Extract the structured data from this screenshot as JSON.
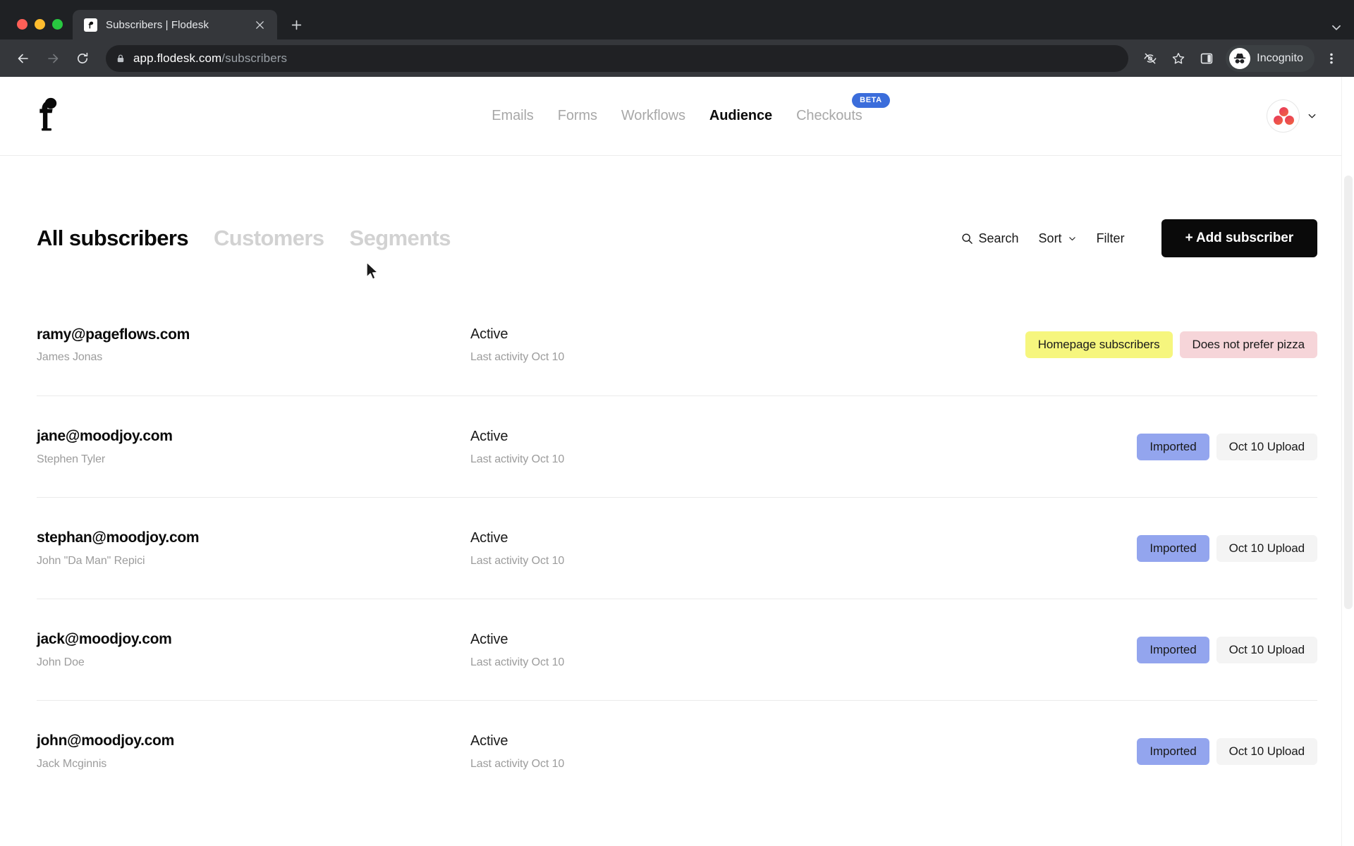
{
  "browser": {
    "tab": {
      "title": "Subscribers | Flodesk",
      "favicon": "flodesk-f-icon",
      "close_label": "×"
    },
    "new_tab_label": "+",
    "back_label": "←",
    "forward_label": "→",
    "reload_label": "⟳",
    "address": {
      "host": "app.flodesk.com",
      "path": "/subscribers",
      "lock_icon": "lock-icon"
    },
    "actions": {
      "third_party_cookies_icon": "eye-slash-icon",
      "bookmark_icon": "star-icon",
      "side_panel_icon": "side-panel-icon",
      "incognito_label": "Incognito",
      "incognito_icon": "incognito-hat-icon",
      "menu_icon": "kebab-menu-icon"
    }
  },
  "app": {
    "brand": {
      "logo_icon": "flodesk-logo-icon"
    },
    "nav": [
      {
        "label": "Emails",
        "active": false
      },
      {
        "label": "Forms",
        "active": false
      },
      {
        "label": "Workflows",
        "active": false
      },
      {
        "label": "Audience",
        "active": true
      },
      {
        "label": "Checkouts",
        "active": false,
        "badge": "BETA"
      }
    ],
    "account": {
      "avatar_icon": "user-avatar-icon",
      "chevron_icon": "chevron-down-icon"
    }
  },
  "page": {
    "view_tabs": [
      {
        "label": "All subscribers",
        "active": true
      },
      {
        "label": "Customers",
        "active": false
      },
      {
        "label": "Segments",
        "active": false
      }
    ],
    "actions": {
      "search_label": "Search",
      "search_icon": "search-icon",
      "sort_label": "Sort",
      "sort_icon": "chevron-down-icon",
      "filter_label": "Filter",
      "add_subscriber_label": "+ Add subscriber"
    },
    "subscribers": [
      {
        "email": "ramy@pageflows.com",
        "name": "James Jonas",
        "status": "Active",
        "activity": "Last activity Oct 10",
        "tags": [
          {
            "label": "Homepage subscribers",
            "bg": "#f6f67e",
            "color": "#1a1a1a"
          },
          {
            "label": "Does not prefer pizza",
            "bg": "#f6d5d9",
            "color": "#1a1a1a"
          }
        ]
      },
      {
        "email": "jane@moodjoy.com",
        "name": "Stephen Tyler",
        "status": "Active",
        "activity": "Last activity Oct 10",
        "tags": [
          {
            "label": "Imported",
            "bg": "#93a5ee",
            "color": "#1a1a1a"
          },
          {
            "label": "Oct 10 Upload",
            "bg": "#f4f4f4",
            "color": "#1a1a1a"
          }
        ]
      },
      {
        "email": "stephan@moodjoy.com",
        "name": "John \"Da Man\" Repici",
        "status": "Active",
        "activity": "Last activity Oct 10",
        "tags": [
          {
            "label": "Imported",
            "bg": "#93a5ee",
            "color": "#1a1a1a"
          },
          {
            "label": "Oct 10 Upload",
            "bg": "#f4f4f4",
            "color": "#1a1a1a"
          }
        ]
      },
      {
        "email": "jack@moodjoy.com",
        "name": "John Doe",
        "status": "Active",
        "activity": "Last activity Oct 10",
        "tags": [
          {
            "label": "Imported",
            "bg": "#93a5ee",
            "color": "#1a1a1a"
          },
          {
            "label": "Oct 10 Upload",
            "bg": "#f4f4f4",
            "color": "#1a1a1a"
          }
        ]
      },
      {
        "email": "john@moodjoy.com",
        "name": "Jack Mcginnis",
        "status": "Active",
        "activity": "Last activity Oct 10",
        "tags": [
          {
            "label": "Imported",
            "bg": "#93a5ee",
            "color": "#1a1a1a"
          },
          {
            "label": "Oct 10 Upload",
            "bg": "#f4f4f4",
            "color": "#1a1a1a"
          }
        ]
      }
    ]
  },
  "colors": {
    "accent_dark": "#0a0a0a",
    "beta_blue": "#3b6ddb",
    "tag_yellow": "#f6f67e",
    "tag_pink": "#f6d5d9",
    "tag_blue": "#93a5ee",
    "tag_gray": "#f4f4f4"
  }
}
